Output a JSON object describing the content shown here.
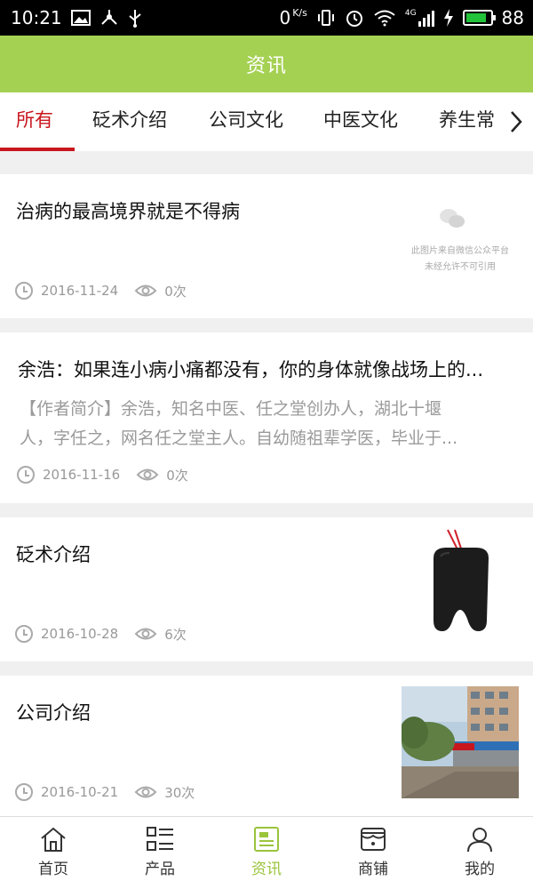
{
  "status_bar": {
    "time": "10:21",
    "network_speed": "0",
    "network_unit": "K/s",
    "signal_label": "4G",
    "battery": "88",
    "battery_level": 0.88
  },
  "header": {
    "title": "资讯"
  },
  "tabs": [
    {
      "label": "所有",
      "active": true
    },
    {
      "label": "砭术介绍"
    },
    {
      "label": "公司文化"
    },
    {
      "label": "中医文化"
    },
    {
      "label": "养生常"
    }
  ],
  "articles": [
    {
      "title": "治病的最高境界就是不得病",
      "date": "2016-11-24",
      "views": "0次",
      "thumb_caption_1": "此图片来自微信公众平台",
      "thumb_caption_2": "未经允许不可引用"
    },
    {
      "title": "余浩：如果连小病小痛都没有，你的身体就像战场上的...",
      "desc_line_1": "【作者简介】余浩，知名中医、任之堂创办人，湖北十堰",
      "desc_line_2": "人，字任之，网名任之堂主人。自幼随祖辈学医，毕业于...",
      "date": "2016-11-16",
      "views": "0次"
    },
    {
      "title": "砭术介绍",
      "date": "2016-10-28",
      "views": "6次"
    },
    {
      "title": "公司介绍",
      "date": "2016-10-21",
      "views": "30次"
    }
  ],
  "bottom_nav": [
    {
      "label": "首页",
      "icon": "home-icon"
    },
    {
      "label": "产品",
      "icon": "list-icon"
    },
    {
      "label": "资讯",
      "icon": "news-icon",
      "active": true
    },
    {
      "label": "商铺",
      "icon": "store-icon"
    },
    {
      "label": "我的",
      "icon": "user-icon"
    }
  ],
  "colors": {
    "header": "#a5d153",
    "active_tab": "#c8161d",
    "nav_active": "#9ac43c"
  }
}
